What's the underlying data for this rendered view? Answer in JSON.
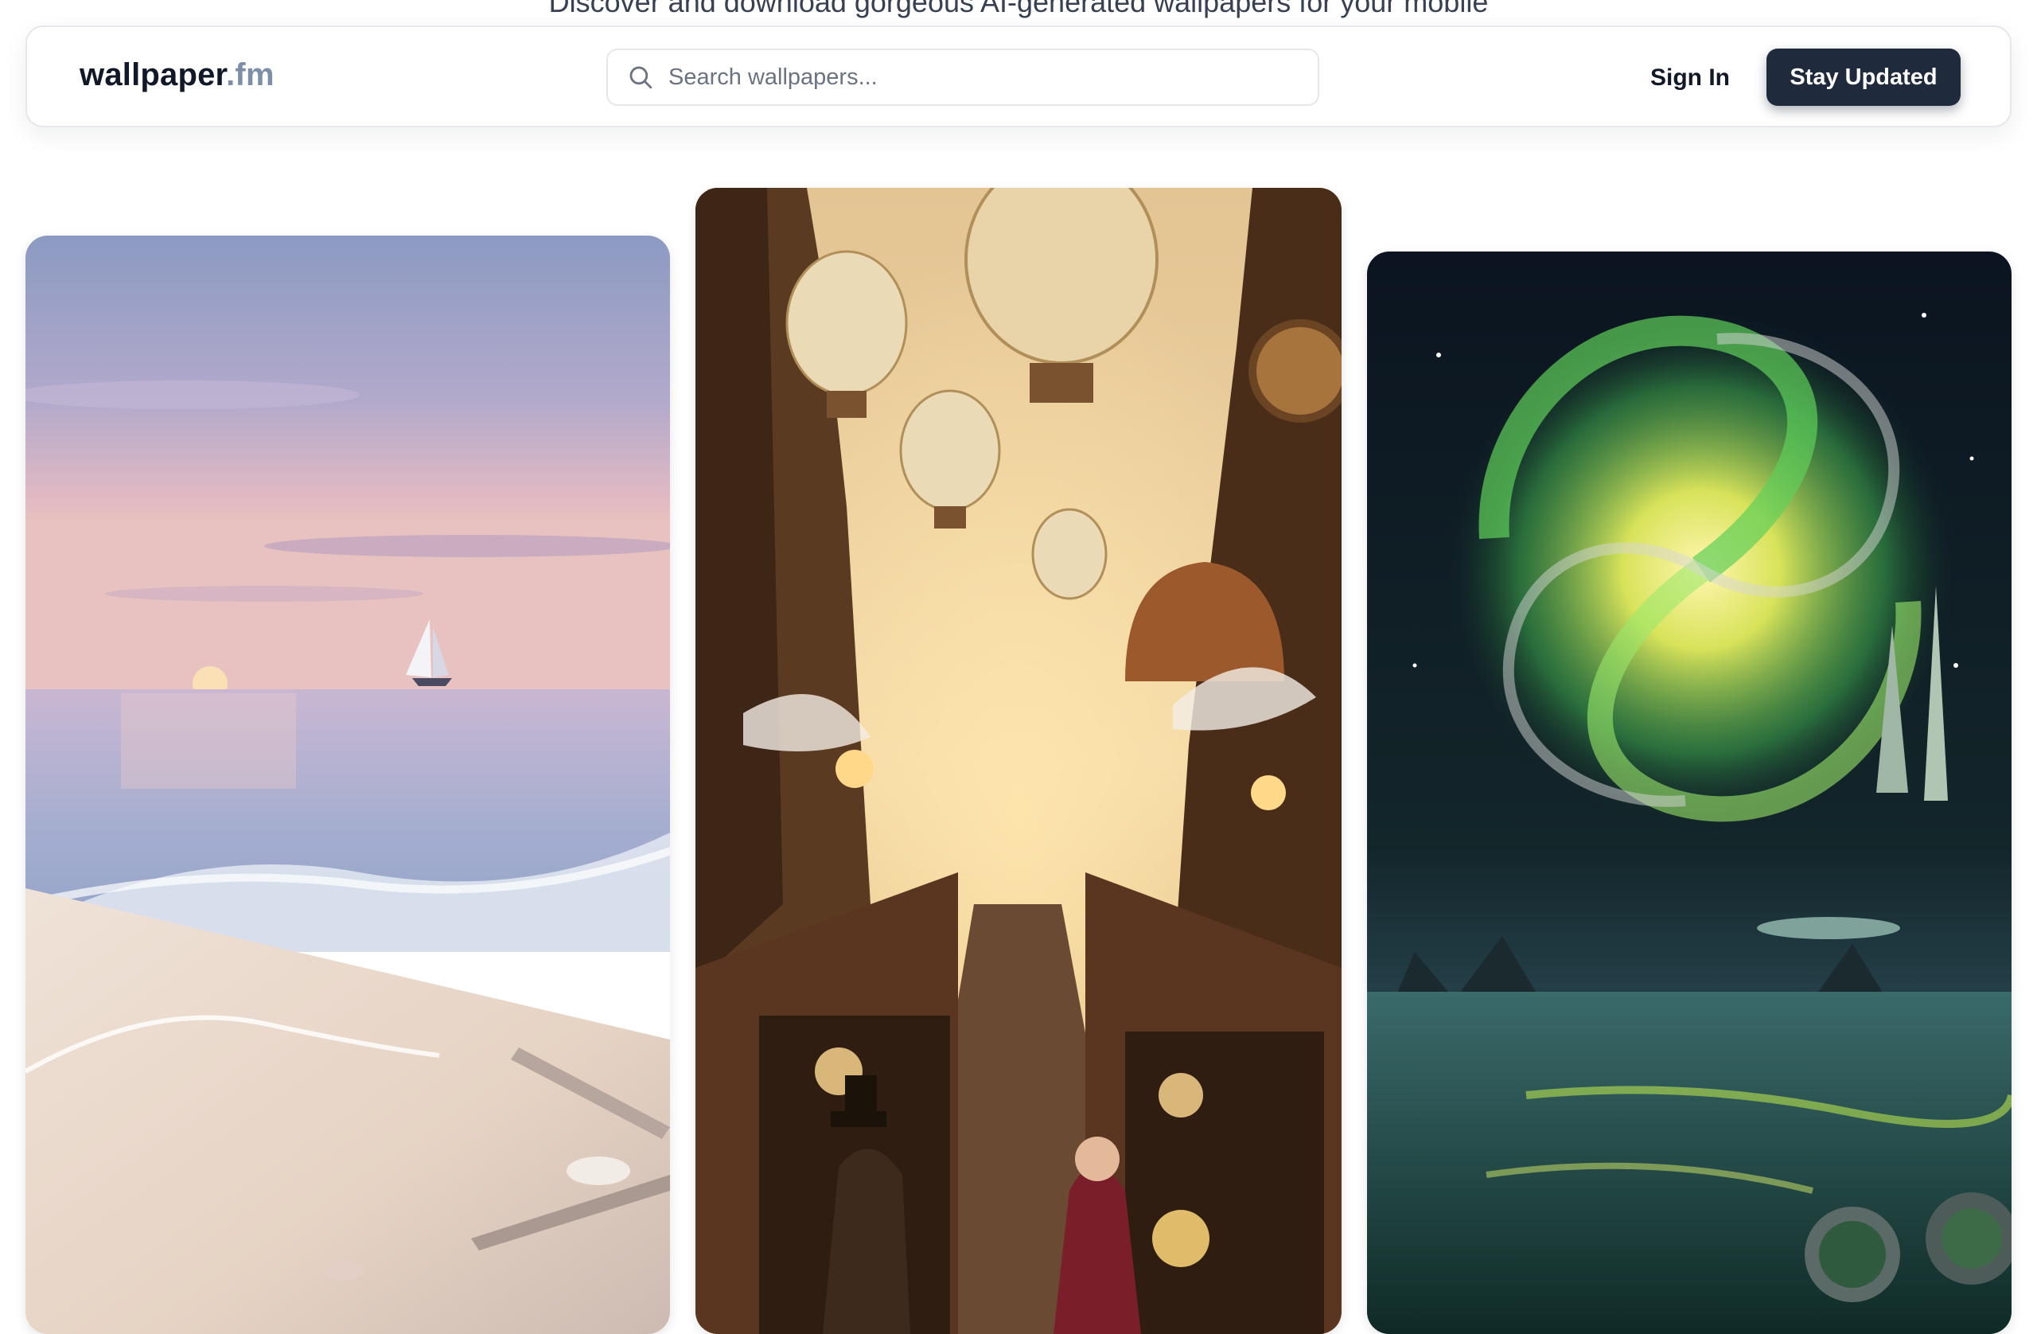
{
  "header": {
    "tagline": "Discover and download gorgeous AI-generated wallpapers for your mobile",
    "logo": {
      "name": "wallpaper",
      "tld": ".fm"
    },
    "search": {
      "placeholder": "Search wallpapers...",
      "icon": "search-icon"
    },
    "sign_in_label": "Sign In",
    "cta_label": "Stay Updated"
  },
  "colors": {
    "cta_background": "#1f2a3c",
    "logo_tld": "#7c8fa6",
    "border": "#e5e7eb"
  },
  "wallpapers": [
    {
      "scene": "beach-sunset-sailboat"
    },
    {
      "scene": "steampunk-market-airships"
    },
    {
      "scene": "spiral-galaxy-alien-lake"
    }
  ]
}
